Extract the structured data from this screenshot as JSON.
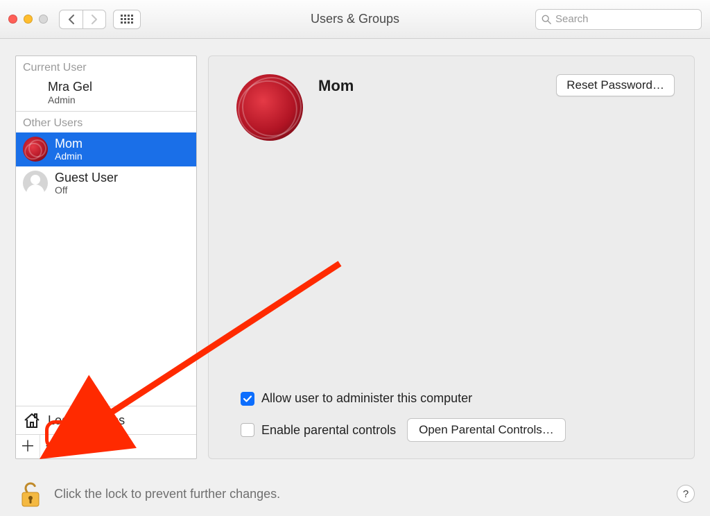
{
  "window_title": "Users & Groups",
  "search": {
    "placeholder": "Search"
  },
  "sidebar": {
    "current_user_label": "Current User",
    "other_users_label": "Other Users",
    "current_user": {
      "name": "Mra Gel",
      "role": "Admin"
    },
    "other_users": [
      {
        "name": "Mom",
        "role": "Admin",
        "selected": true,
        "avatar": "rose"
      },
      {
        "name": "Guest User",
        "role": "Off",
        "selected": false,
        "avatar": "guest"
      }
    ],
    "login_options_label": "Login Options"
  },
  "detail": {
    "user_name": "Mom",
    "reset_password_label": "Reset Password…",
    "admin_checkbox_label": "Allow user to administer this computer",
    "admin_checkbox_checked": true,
    "parental_checkbox_label": "Enable parental controls",
    "parental_checkbox_checked": false,
    "open_parental_label": "Open Parental Controls…"
  },
  "lockbar": {
    "text": "Click the lock to prevent further changes.",
    "help_label": "?"
  }
}
